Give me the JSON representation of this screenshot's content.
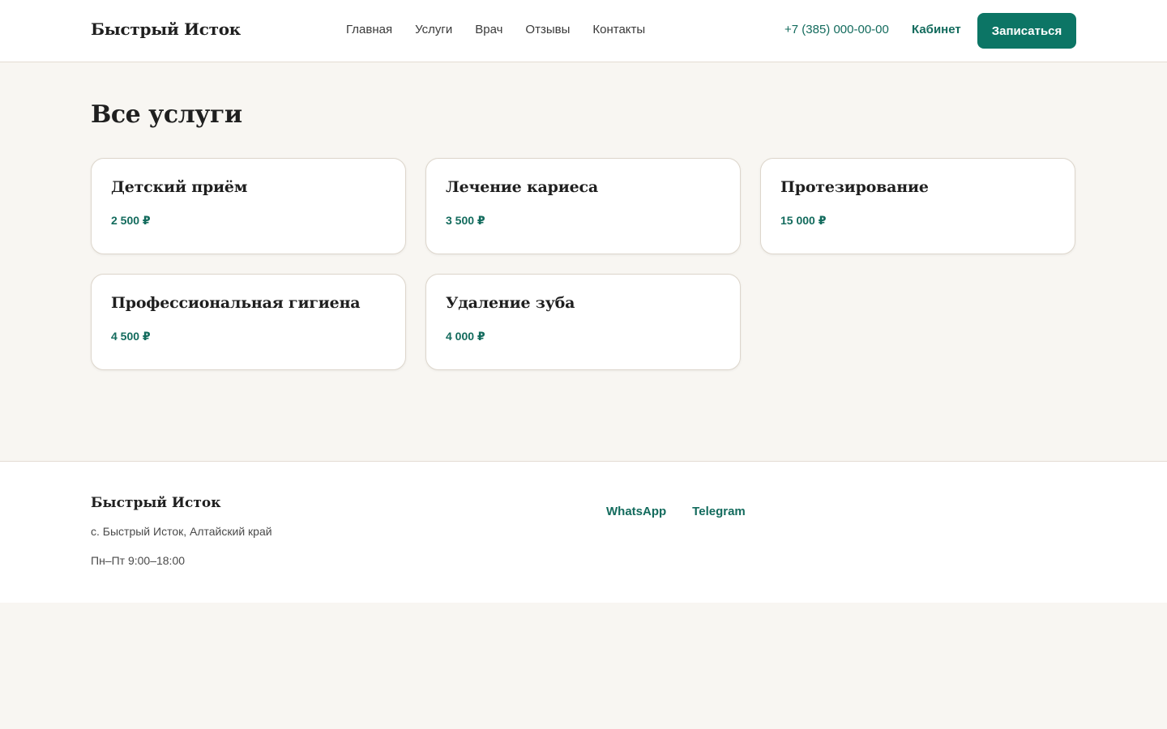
{
  "header": {
    "logo": "Быстрый Исток",
    "nav": [
      {
        "label": "Главная"
      },
      {
        "label": "Услуги"
      },
      {
        "label": "Врач"
      },
      {
        "label": "Отзывы"
      },
      {
        "label": "Контакты"
      }
    ],
    "phone": "+7 (385) 000-00-00",
    "cabinet_label": "Кабинет",
    "cta_label": "Записаться"
  },
  "main": {
    "title": "Все услуги",
    "services": [
      {
        "name": "Детский приём",
        "price": "2 500 ₽"
      },
      {
        "name": "Лечение кариеса",
        "price": "3 500 ₽"
      },
      {
        "name": "Протезирование",
        "price": "15 000 ₽"
      },
      {
        "name": "Профессиональная гигиена",
        "price": "4 500 ₽"
      },
      {
        "name": "Удаление зуба",
        "price": "4 000 ₽"
      }
    ]
  },
  "footer": {
    "logo": "Быстрый Исток",
    "address": "с. Быстрый Исток, Алтайский край",
    "hours": "Пн–Пт 9:00–18:00",
    "links": [
      {
        "label": "WhatsApp"
      },
      {
        "label": "Telegram"
      }
    ]
  },
  "colors": {
    "accent": "#0c7565",
    "accent_text": "#136b5d",
    "background": "#f8f6f2"
  }
}
